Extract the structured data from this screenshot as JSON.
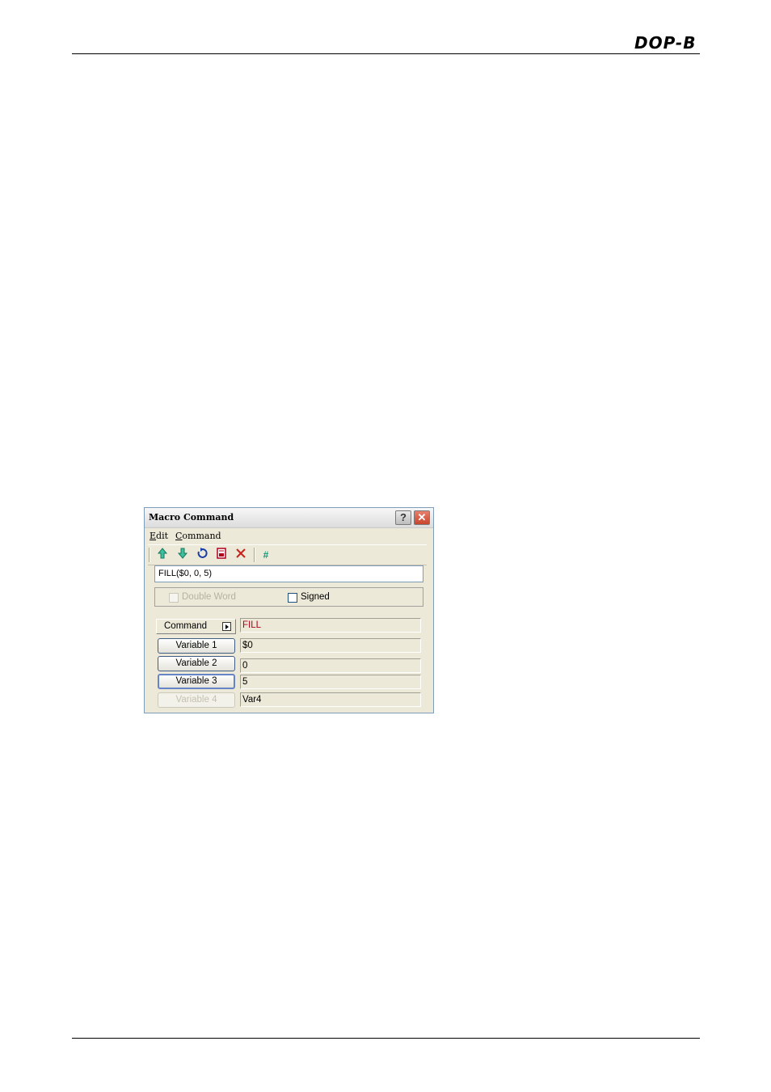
{
  "page": {
    "logo_text": "DOP-B"
  },
  "dialog": {
    "title": "Macro Command",
    "help_glyph": "?",
    "close_glyph": "✕",
    "menu": {
      "edit_first": "E",
      "edit_rest": "dit",
      "command_first": "C",
      "command_rest": "ommand"
    },
    "toolbar": {
      "icons": [
        "move-up-icon",
        "move-down-icon",
        "undo-icon",
        "save-icon",
        "delete-icon",
        "hash-icon"
      ]
    },
    "expression": "FILL($0, 0, 5)",
    "options": {
      "double_word_label": "Double Word",
      "double_word_enabled": false,
      "double_word_checked": false,
      "signed_label": "Signed",
      "signed_checked": false
    },
    "command": {
      "label": "Command",
      "value": "FILL"
    },
    "variables": [
      {
        "label": "Variable 1",
        "value": "$0",
        "enabled": true
      },
      {
        "label": "Variable 2",
        "value": "0",
        "enabled": true
      },
      {
        "label": "Variable 3",
        "value": "5",
        "enabled": true,
        "focused": true
      },
      {
        "label": "Variable 4",
        "value": "Var4",
        "enabled": false
      }
    ]
  }
}
